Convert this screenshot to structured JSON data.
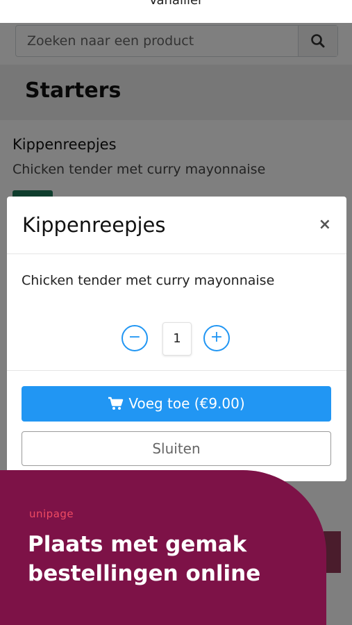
{
  "topbar": {
    "title": "Vanallier"
  },
  "search": {
    "placeholder": "Zoeken naar een product"
  },
  "section": {
    "title": "Starters"
  },
  "product": {
    "name": "Kippenreepjes",
    "description": "Chicken tender met curry mayonnaise"
  },
  "modal": {
    "title": "Kippenreepjes",
    "close_symbol": "×",
    "description": "Chicken tender met curry mayonnaise",
    "quantity": "1",
    "minus_symbol": "−",
    "plus_symbol": "+",
    "add_label": "Voeg toe (€9.00)",
    "close_label": "Sluiten"
  },
  "promo": {
    "brand": "unipage",
    "headline": "Plaats met gemak bestellingen online"
  },
  "colors": {
    "primary": "#2196f3",
    "promo_bg": "#7d1247",
    "brand": "#f04b63"
  },
  "icons": {
    "search": "search-icon",
    "cart": "cart-icon",
    "close": "close-icon"
  }
}
